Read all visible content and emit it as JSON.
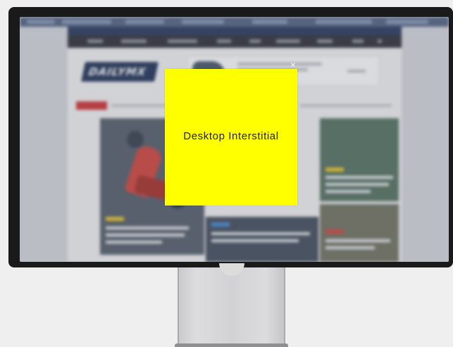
{
  "interstitial": {
    "label": "Desktop Interstitial",
    "background_color": "#ffff00",
    "close_icon": "close-icon",
    "close_glyph": "×"
  },
  "background_site": {
    "logo_text": "DAILYMX",
    "brand_color": "#16284f",
    "breaking_badge_color": "#cf2a2a",
    "blurred": true
  },
  "device": {
    "type": "desktop-monitor",
    "bezel_color": "#1a1a1a",
    "stand_color": "#d2d2d4"
  }
}
